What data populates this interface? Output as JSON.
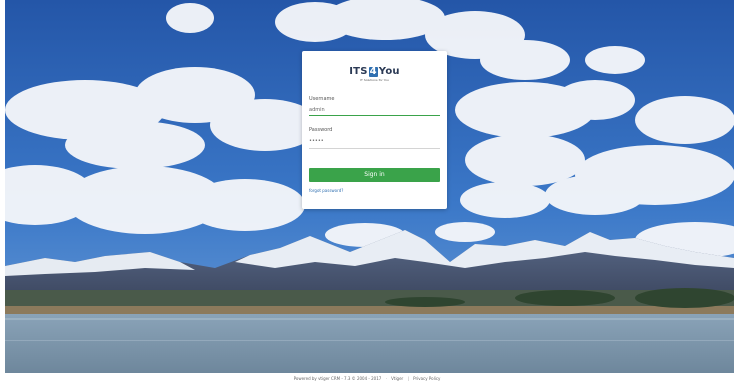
{
  "login": {
    "logo_text_left": "ITS",
    "logo_text_mark": "4",
    "logo_text_right": "You",
    "logo_subtitle": "IT Solutions for You",
    "username_label": "Username",
    "username_value": "admin",
    "password_label": "Password",
    "password_value": "•••••",
    "signin_label": "Sign in",
    "forgot_label": "forgot password?"
  },
  "footer": {
    "powered_text": "Powered by vtiger CRM - 7.3 © 2004 - 2017",
    "vtiger_link": "Vtiger",
    "separator": "|",
    "privacy_link": "Privacy Policy"
  },
  "colors": {
    "accent_green": "#3aa34a",
    "link_blue": "#2f6fb0",
    "sky_blue": "#2f67b6"
  }
}
